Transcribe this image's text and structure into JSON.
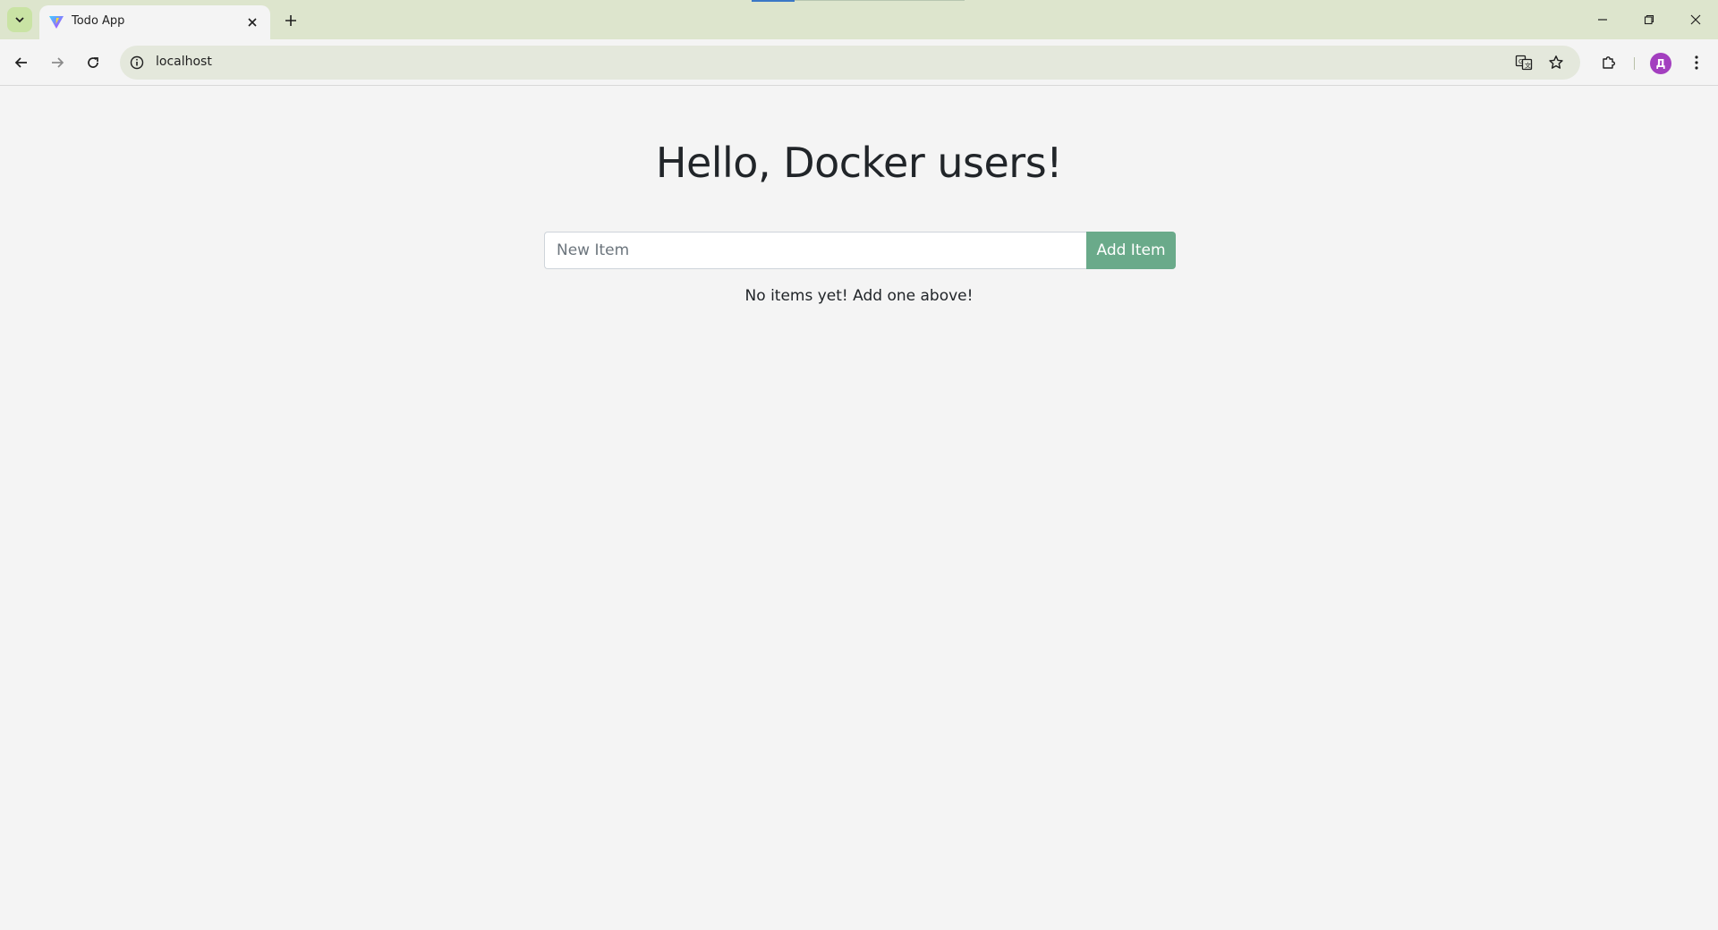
{
  "browser": {
    "tab_title": "Todo App",
    "url": "localhost",
    "profile_initial": "Д"
  },
  "icons": {
    "tab_search": "chevron-down-icon",
    "tab_close": "close-icon",
    "new_tab": "plus-icon",
    "back": "arrow-left-icon",
    "forward": "arrow-right-icon",
    "reload": "reload-icon",
    "site_info": "info-icon",
    "translate": "translate-icon",
    "bookmark": "star-icon",
    "extensions": "puzzle-icon",
    "menu": "kebab-menu-icon",
    "minimize": "minimize-icon",
    "maximize": "restore-icon",
    "close_window": "close-icon"
  },
  "colors": {
    "accent_button": "#6aaa8a",
    "tabstrip": "#dde5cd",
    "avatar": "#a33fbf"
  },
  "app": {
    "heading": "Hello, Docker users!",
    "new_item_placeholder": "New Item",
    "new_item_value": "",
    "add_button_label": "Add Item",
    "empty_message": "No items yet! Add one above!"
  }
}
